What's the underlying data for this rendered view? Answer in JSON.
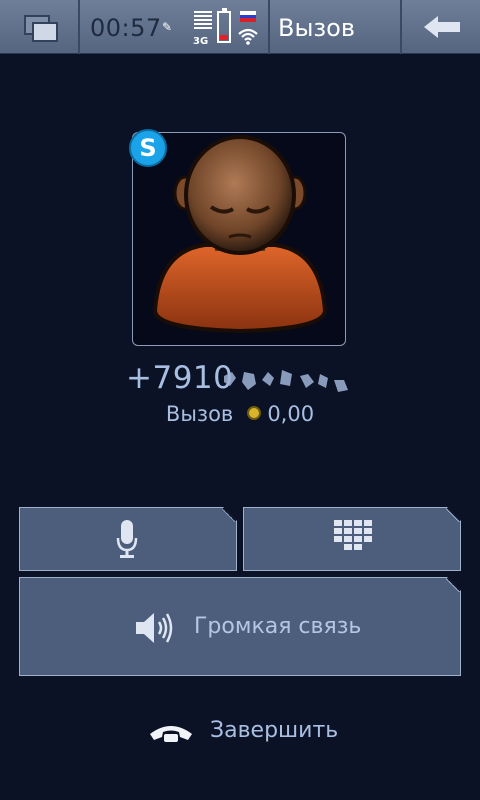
{
  "status_bar": {
    "clock": "00:57",
    "network_type": "3G",
    "title": "Вызов",
    "icons": [
      "task-switcher-icon",
      "pen-icon",
      "signal-icon",
      "battery-icon",
      "flag-icon",
      "wifi-icon",
      "back-arrow-icon"
    ]
  },
  "call": {
    "number": "+7910",
    "status_label": "Вызов",
    "balance": "0,00"
  },
  "buttons": {
    "speaker_label": "Громкая связь",
    "end_call_label": "Завершить"
  },
  "colors": {
    "background": "#0c1226",
    "status_bar": "#6f7f99",
    "button": "#4c5e7c",
    "text": "#a8bfe2",
    "battery_low": "#e0202a"
  }
}
